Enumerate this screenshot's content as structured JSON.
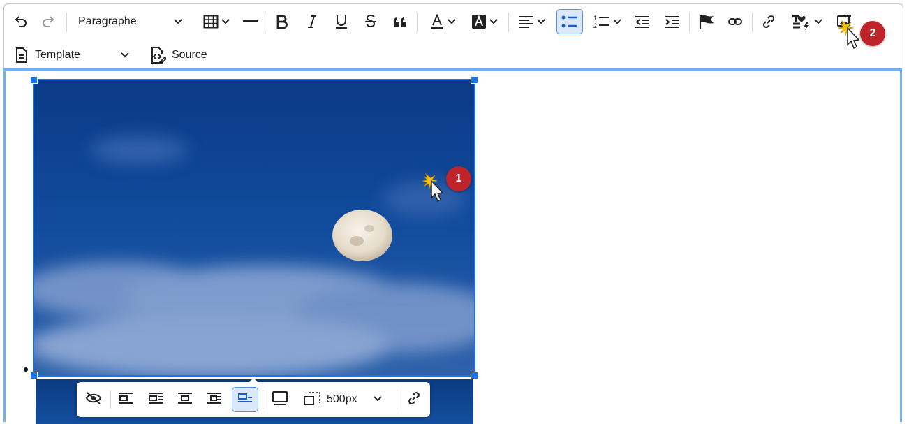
{
  "toolbar": {
    "paragraph_select": "Paragraphe",
    "template_select": "Template",
    "source_label": "Source"
  },
  "image_toolbar": {
    "width_value": "500px"
  },
  "markers": {
    "m1": "1",
    "m2": "2"
  },
  "colors": {
    "accent": "#1a73e8",
    "content_border": "#6fb0f4",
    "marker": "#c0242b",
    "active_bg": "#dbe8fb"
  },
  "icons": [
    "undo-icon",
    "redo-icon",
    "table-icon",
    "horizontal-line-icon",
    "bold-icon",
    "italic-icon",
    "underline-icon",
    "strikethrough-icon",
    "blockquote-icon",
    "font-color-icon",
    "background-color-icon",
    "align-icon",
    "bulleted-list-icon",
    "numbered-list-icon",
    "outdent-icon",
    "indent-icon",
    "flag-icon",
    "unlink-icon",
    "link-icon",
    "special-chars-icon",
    "image-upload-icon",
    "document-icon",
    "source-icon",
    "hide-icon",
    "wrap-left-icon",
    "wrap-right-icon",
    "align-center-icon",
    "inline-icon",
    "break-text-icon",
    "caption-icon",
    "resize-icon",
    "image-link-icon"
  ]
}
